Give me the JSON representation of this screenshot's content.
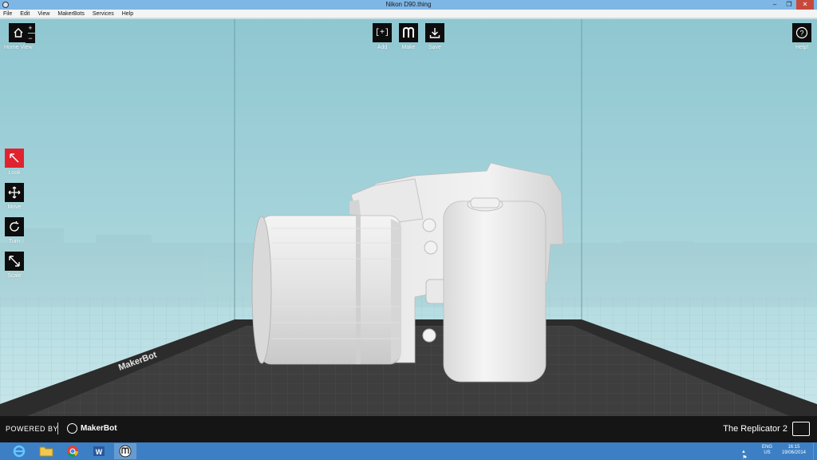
{
  "window": {
    "title": "Nikon D90.thing"
  },
  "menu": [
    "File",
    "Edit",
    "View",
    "MakerBots",
    "Services",
    "Help"
  ],
  "toolbar": {
    "home": "Home View",
    "zoom_in": "+",
    "zoom_out": "−",
    "add": "Add",
    "make": "Make",
    "save": "Save",
    "help": "Help!",
    "look": "Look",
    "move": "Move",
    "turn": "Turn",
    "scale": "Scale"
  },
  "platform_brand": "MakerBot",
  "footer": {
    "powered_by": "POWERED BY",
    "brand": "MakerBot",
    "printer": "The Replicator 2"
  },
  "taskbar": {
    "apps": [
      "internet-explorer",
      "file-explorer",
      "chrome",
      "word",
      "makerware"
    ],
    "lang_top": "ENG",
    "lang_bottom": "US",
    "time": "16:15",
    "date": "19/06/2014"
  },
  "colors": {
    "active_tool": "#e0232f",
    "sky": "#9ccdd5",
    "platform": "#3a3a3a",
    "taskbar": "#3c7fc4"
  }
}
